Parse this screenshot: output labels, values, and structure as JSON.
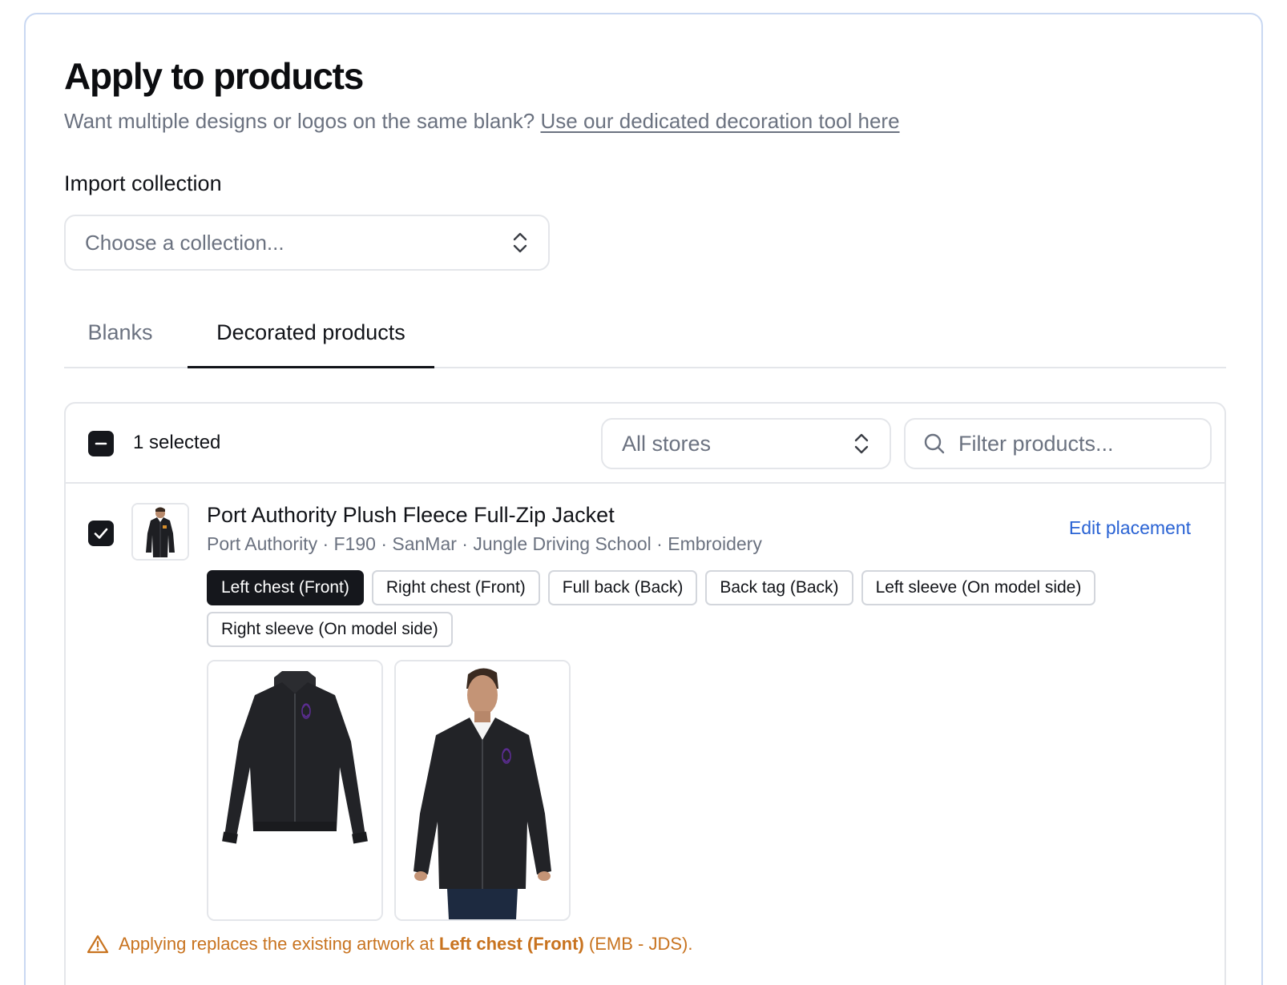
{
  "header": {
    "title": "Apply to products",
    "subtitle_text": "Want multiple designs or logos on the same blank?",
    "subtitle_link": "Use our dedicated decoration tool here"
  },
  "import_collection": {
    "label": "Import collection",
    "placeholder": "Choose a collection..."
  },
  "tabs": [
    {
      "label": "Blanks",
      "active": false
    },
    {
      "label": "Decorated products",
      "active": true
    }
  ],
  "list_header": {
    "selected_text": "1 selected",
    "stores_value": "All stores",
    "filter_placeholder": "Filter products..."
  },
  "product": {
    "name": "Port Authority Plush Fleece Full-Zip Jacket",
    "meta": "Port Authority · F190 · SanMar · Jungle Driving School · Embroidery",
    "edit_label": "Edit placement",
    "selected": true,
    "placements": [
      {
        "label": "Left chest (Front)",
        "active": true
      },
      {
        "label": "Right chest (Front)",
        "active": false
      },
      {
        "label": "Full back (Back)",
        "active": false
      },
      {
        "label": "Back tag (Back)",
        "active": false
      },
      {
        "label": "Left sleeve (On model side)",
        "active": false
      },
      {
        "label": "Right sleeve (On model side)",
        "active": false
      }
    ]
  },
  "warning": {
    "prefix": "Applying replaces the existing artwork at",
    "placement": "Left chest (Front)",
    "suffix": "(EMB - JDS)."
  },
  "colors": {
    "accent_link": "#2a63d4",
    "warning": "#c8731f",
    "checkbox": "#15171c",
    "card_border": "#c9d8f2"
  }
}
